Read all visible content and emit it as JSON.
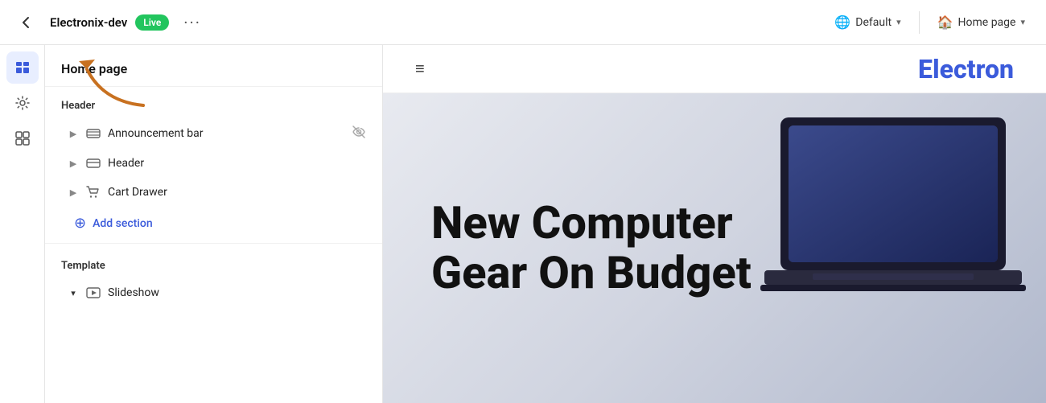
{
  "topbar": {
    "back_label": "←",
    "site_name": "Electronix-dev",
    "live_label": "Live",
    "more_label": "···",
    "default_label": "Default",
    "default_icon": "🌐",
    "home_page_label": "Home page",
    "home_page_icon": "🏠"
  },
  "sidebar": {
    "icons": [
      {
        "id": "sections",
        "label": "sections-icon",
        "active": true
      },
      {
        "id": "settings",
        "label": "settings-icon",
        "active": false
      },
      {
        "id": "apps",
        "label": "apps-icon",
        "active": false
      }
    ]
  },
  "panel": {
    "title": "Home page",
    "groups": [
      {
        "id": "header",
        "label": "Header",
        "items": [
          {
            "id": "announcement-bar",
            "label": "Announcement bar",
            "has_chevron": true,
            "hidden": true
          },
          {
            "id": "header",
            "label": "Header",
            "has_chevron": true,
            "hidden": false
          },
          {
            "id": "cart-drawer",
            "label": "Cart Drawer",
            "has_chevron": true,
            "hidden": false
          }
        ],
        "add_section_label": "Add section"
      },
      {
        "id": "template",
        "label": "Template",
        "items": [
          {
            "id": "slideshow",
            "label": "Slideshow",
            "has_chevron": true,
            "expanded": true
          }
        ]
      }
    ]
  },
  "preview": {
    "nav": {
      "hamburger": "≡",
      "logo": "Electron"
    },
    "hero": {
      "title_line1": "New Computer",
      "title_line2": "Gear On Budget"
    }
  },
  "colors": {
    "accent": "#3b5bdb",
    "live_green": "#22c55e",
    "arrow_orange": "#c87120"
  }
}
